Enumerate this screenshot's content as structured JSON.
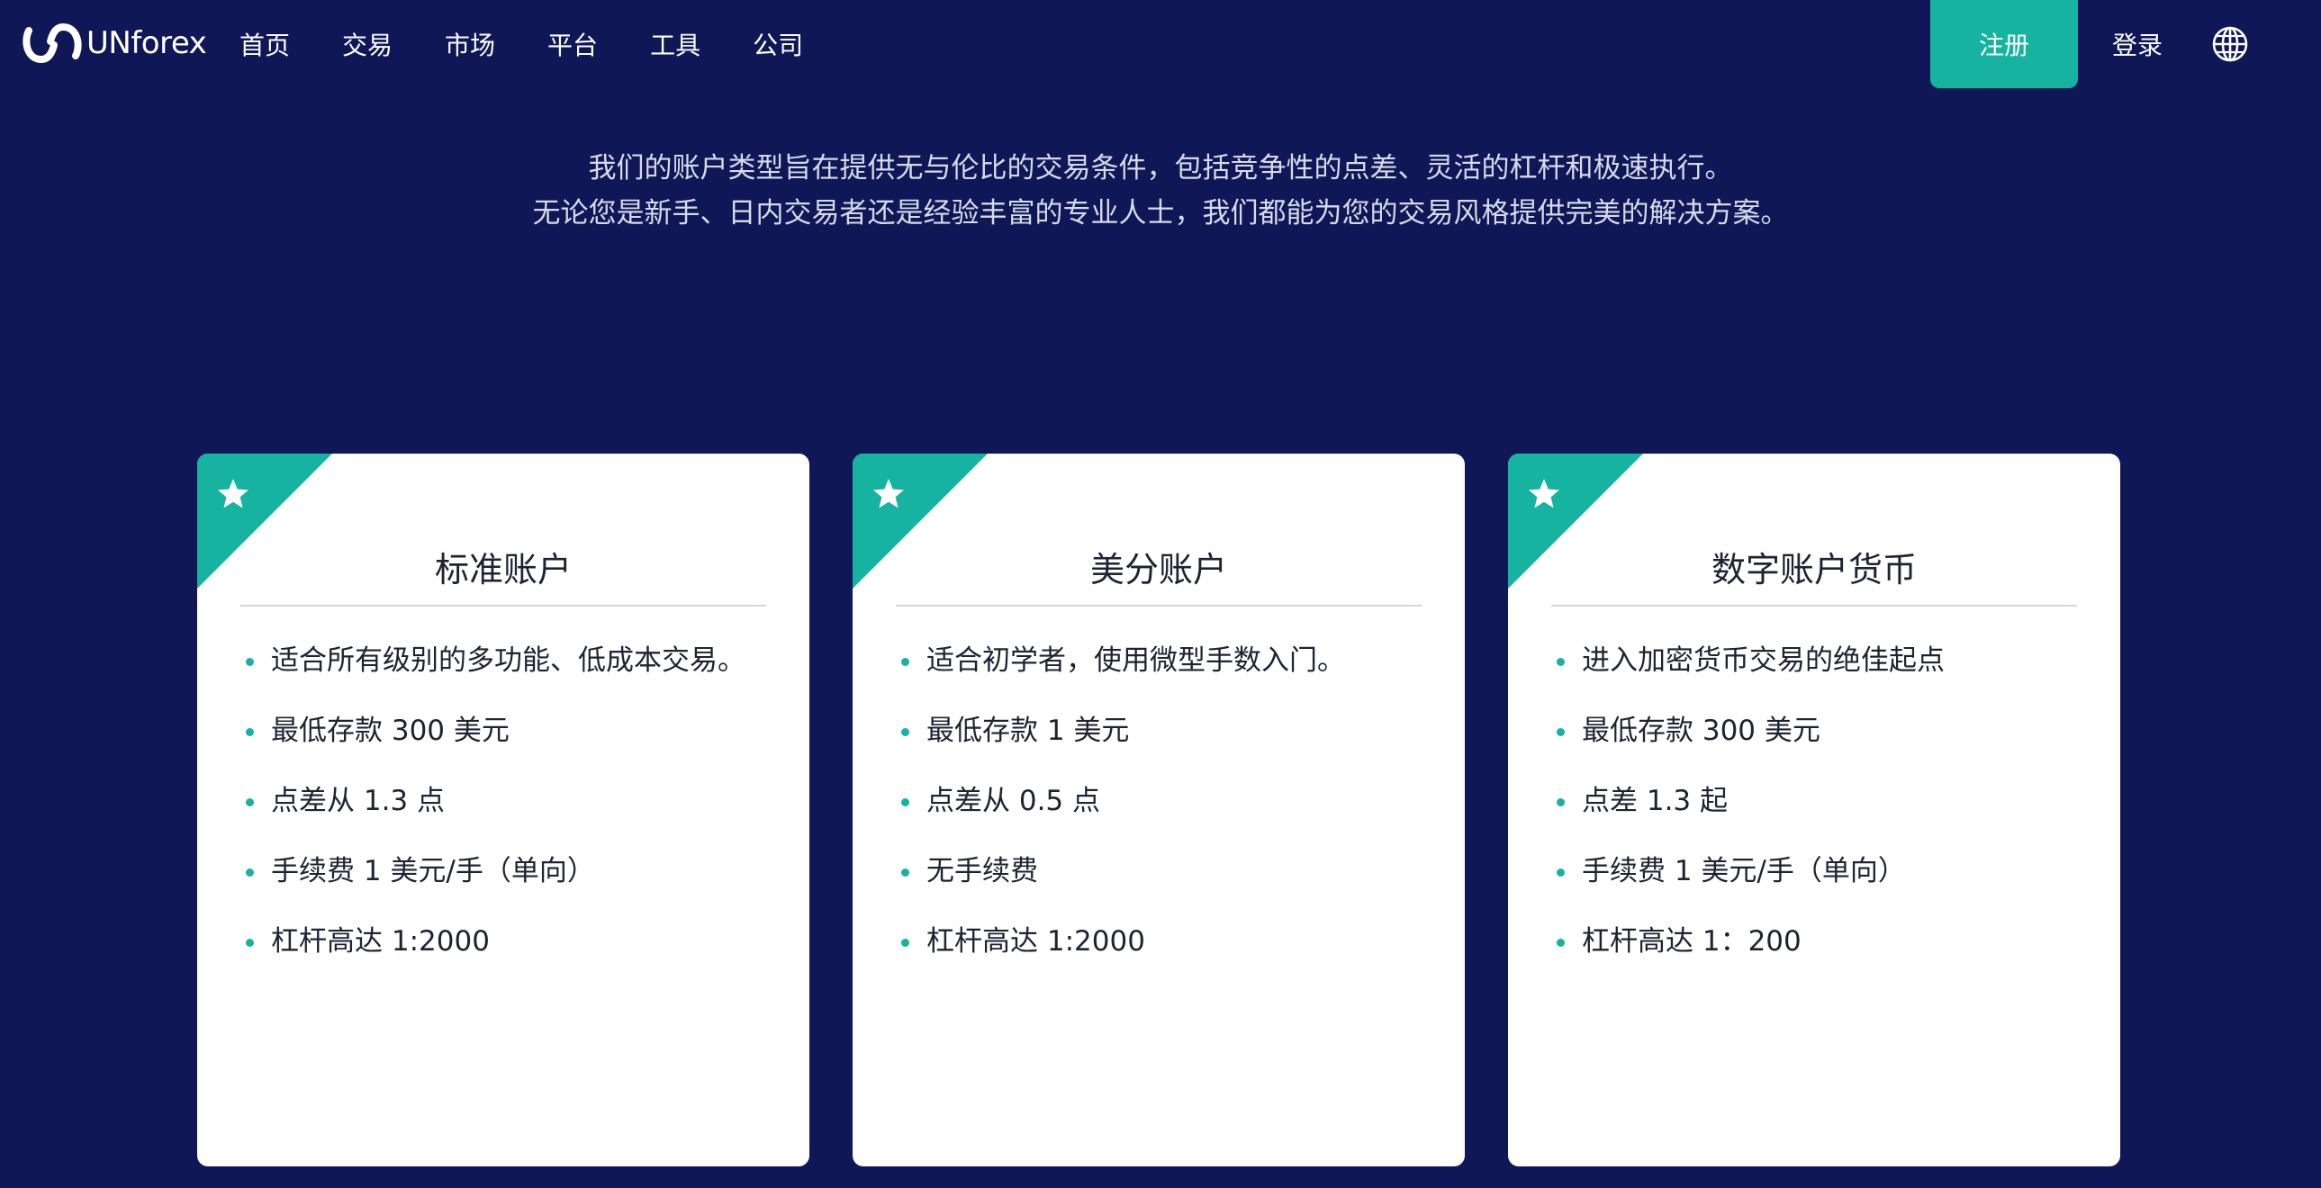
{
  "brand": {
    "name": "UNforex",
    "accent_color": "#15b3a0",
    "background_color": "#0f1757"
  },
  "nav": {
    "items": [
      {
        "label": "首页"
      },
      {
        "label": "交易"
      },
      {
        "label": "市场"
      },
      {
        "label": "平台"
      },
      {
        "label": "工具"
      },
      {
        "label": "公司"
      }
    ],
    "register_label": "注册",
    "login_label": "登录",
    "language_icon": "globe-icon"
  },
  "intro": {
    "line1": "我们的账户类型旨在提供无与伦比的交易条件，包括竞争性的点差、灵活的杠杆和极速执行。",
    "line2": "无论您是新手、日内交易者还是经验丰富的专业人士，我们都能为您的交易风格提供完美的解决方案。"
  },
  "cards": [
    {
      "title": "标准账户",
      "badge_icon": "star-icon",
      "features": [
        "适合所有级别的多功能、低成本交易。",
        "最低存款 300 美元",
        "点差从 1.3 点",
        "手续费 1 美元/手（单向）",
        "杠杆高达 1:2000"
      ]
    },
    {
      "title": "美分账户",
      "badge_icon": "star-icon",
      "features": [
        "适合初学者，使用微型手数入门。",
        "最低存款 1 美元",
        "点差从 0.5 点",
        "无手续费",
        "杠杆高达 1:2000"
      ]
    },
    {
      "title": "数字账户货币",
      "badge_icon": "star-icon",
      "features": [
        "进入加密货币交易的绝佳起点",
        "最低存款 300 美元",
        "点差 1.3 起",
        "手续费 1 美元/手（单向）",
        "杠杆高达 1：200"
      ]
    }
  ]
}
